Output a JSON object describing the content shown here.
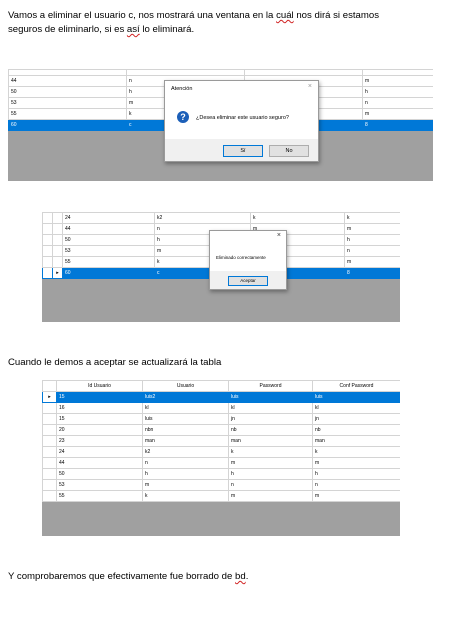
{
  "paragraphs": {
    "p1_line1": "Vamos a eliminar el usuario c, nos mostrará una ventana en la",
    "p1_word_cual": "cuál",
    "p1_line1_end": "nos dirá si estamos",
    "p1_line2_start": "seguros de eliminarlo, si es",
    "p1_word_asi": "así",
    "p1_line2_end": "lo eliminará.",
    "p2": "Cuando le demos a aceptar se actualizará la tabla",
    "p3_start": "Y comprobaremos que efectivamente fue borrado de",
    "p3_word_bd": "bd",
    "p3_end": "."
  },
  "shot1": {
    "rows": [
      {
        "c1": "44",
        "c2": "n",
        "c3": "",
        "c4": "m",
        "selected": false
      },
      {
        "c1": "50",
        "c2": "h",
        "c3": "",
        "c4": "h",
        "selected": false
      },
      {
        "c1": "53",
        "c2": "m",
        "c3": "",
        "c4": "n",
        "selected": false
      },
      {
        "c1": "55",
        "c2": "k",
        "c3": "",
        "c4": "m",
        "selected": false
      },
      {
        "c1": "60",
        "c2": "c",
        "c3": "",
        "c4": "8",
        "selected": true
      }
    ],
    "dialog": {
      "title": "Atención",
      "close": "×",
      "icon": "?",
      "message": "¿Desea eliminar este usuario seguro?",
      "yes": "Sí",
      "no": "No"
    }
  },
  "shot2": {
    "rows": [
      {
        "c1": "24",
        "c2": "k2",
        "c3": "k",
        "c4": "k",
        "selected": false
      },
      {
        "c1": "44",
        "c2": "n",
        "c3": "m",
        "c4": "m",
        "selected": false
      },
      {
        "c1": "50",
        "c2": "h",
        "c3": "h",
        "c4": "h",
        "selected": false
      },
      {
        "c1": "53",
        "c2": "m",
        "c3": "n",
        "c4": "n",
        "selected": false
      },
      {
        "c1": "55",
        "c2": "k",
        "c3": "m",
        "c4": "m",
        "selected": false
      },
      {
        "c1": "60",
        "c2": "c",
        "c3": "8",
        "c4": "8",
        "selected": true
      }
    ],
    "dialog": {
      "close": "×",
      "message": "Eliminado correctamente",
      "ok": "Aceptar"
    }
  },
  "shot3": {
    "headers": [
      "Id Usuario",
      "Usuario",
      "Password",
      "Conf Password"
    ],
    "rows": [
      {
        "c1": "15",
        "c2": "luis2",
        "c3": "luis",
        "c4": "luis",
        "selected": true
      },
      {
        "c1": "16",
        "c2": "kl",
        "c3": "kl",
        "c4": "kl",
        "selected": false
      },
      {
        "c1": "15",
        "c2": "luis",
        "c3": "jn",
        "c4": "jn",
        "selected": false
      },
      {
        "c1": "20",
        "c2": "nbn",
        "c3": "nb",
        "c4": "nb",
        "selected": false
      },
      {
        "c1": "23",
        "c2": "man",
        "c3": "man",
        "c4": "man",
        "selected": false
      },
      {
        "c1": "24",
        "c2": "k2",
        "c3": "k",
        "c4": "k",
        "selected": false
      },
      {
        "c1": "44",
        "c2": "n",
        "c3": "m",
        "c4": "m",
        "selected": false
      },
      {
        "c1": "50",
        "c2": "h",
        "c3": "h",
        "c4": "h",
        "selected": false
      },
      {
        "c1": "53",
        "c2": "m",
        "c3": "n",
        "c4": "n",
        "selected": false
      },
      {
        "c1": "55",
        "c2": "k",
        "c3": "m",
        "c4": "m",
        "selected": false
      }
    ]
  },
  "colors": {
    "selection": "#0078d7",
    "grid_background": "#a0a0a0",
    "icon_blue": "#1c5fb8",
    "spell_underline": "#d02020"
  }
}
